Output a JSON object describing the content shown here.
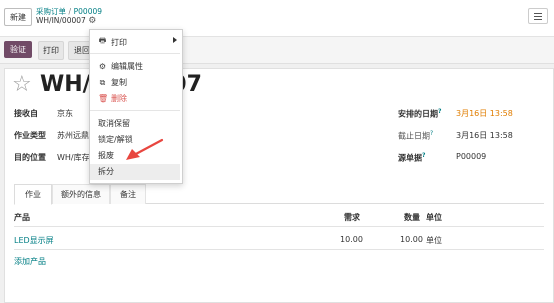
{
  "topbar": {
    "new_button": "新建",
    "breadcrumb": {
      "parent": "采购订单",
      "separator": "/",
      "current_order": "P00009"
    },
    "record_ref": "WH/IN/00007",
    "gear_icon": "gear-icon",
    "menu_icon": "hamburger-icon"
  },
  "actions": {
    "validate": "验证",
    "print": "打印",
    "return": "退回"
  },
  "record": {
    "title": "WH/IN/00007"
  },
  "fields": {
    "receive_from": {
      "label": "接收自",
      "value": "京东"
    },
    "operation_type": {
      "label": "作业类型",
      "value": "苏州远鼎"
    },
    "destination": {
      "label": "目的位置",
      "value": "WH/库存"
    },
    "scheduled_date": {
      "label": "安排的日期",
      "help": "?",
      "value": "3月16日 13:58"
    },
    "deadline": {
      "label": "截止日期",
      "help": "?",
      "value": "3月16日 13:58"
    },
    "source_doc": {
      "label": "源单据",
      "help": "?",
      "value": "P00009"
    }
  },
  "tabs": [
    "作业",
    "额外的信息",
    "备注"
  ],
  "table": {
    "headers": {
      "product": "产品",
      "demand": "需求",
      "quantity": "数量",
      "unit": "单位"
    },
    "rows": [
      {
        "product": "LED显示屏",
        "demand": "10.00",
        "quantity": "10.00",
        "unit": "单位"
      }
    ],
    "add_product": "添加产品"
  },
  "dropdown": {
    "print": {
      "label": "打印",
      "icon": "printer-icon"
    },
    "edit_properties": {
      "label": "编辑属性",
      "icon": "gears-icon"
    },
    "duplicate": {
      "label": "复制",
      "icon": "copy-icon"
    },
    "delete": {
      "label": "删除",
      "icon": "trash-icon"
    },
    "unreserve": "取消保留",
    "lock_unlock": "锁定/解锁",
    "scrap": "报废",
    "split": "拆分"
  },
  "colors": {
    "primary": "#714b67",
    "link": "#017e84",
    "danger": "#d9534f",
    "date_highlight": "#e07d00",
    "annotation_arrow": "#e8463f"
  }
}
